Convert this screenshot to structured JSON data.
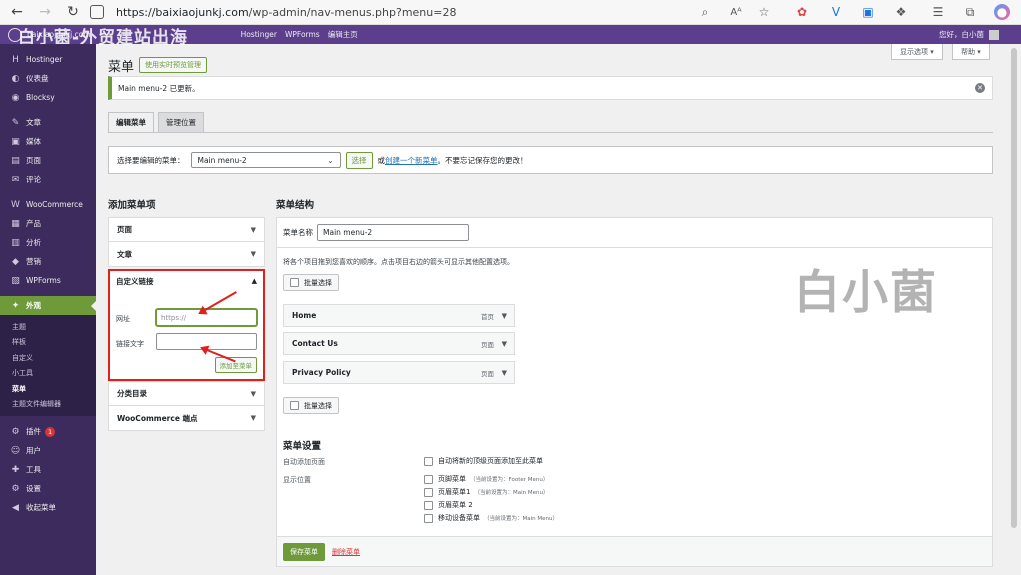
{
  "browser": {
    "url_domain": "https://baixiaojunkj.com",
    "url_path": "/wp-admin/nav-menus.php?menu=28",
    "back": "←",
    "forward": "→",
    "refresh": "↻"
  },
  "adminbar": {
    "overlay_title": "白小菌-外贸建站出海",
    "site": "baixiaojunkj.com",
    "items": [
      "Hostinger",
      "WPForms",
      "编辑主页"
    ],
    "greeting": "您好，白小菌"
  },
  "sidebar": {
    "items": [
      {
        "label": "Hostinger",
        "icon": "H"
      },
      {
        "label": "仪表盘",
        "icon": "◐"
      },
      {
        "label": "Blocksy",
        "icon": "◉"
      },
      {
        "label": "文章",
        "icon": "✎"
      },
      {
        "label": "媒体",
        "icon": "▣"
      },
      {
        "label": "页面",
        "icon": "▤"
      },
      {
        "label": "评论",
        "icon": "✉"
      },
      {
        "label": "WooCommerce",
        "icon": "W"
      },
      {
        "label": "产品",
        "icon": "▦"
      },
      {
        "label": "分析",
        "icon": "▥"
      },
      {
        "label": "营销",
        "icon": "◆"
      },
      {
        "label": "WPForms",
        "icon": "▧"
      },
      {
        "label": "外观",
        "icon": "✦"
      },
      {
        "label": "插件",
        "icon": "⚙",
        "badge": "1"
      },
      {
        "label": "用户",
        "icon": "☺"
      },
      {
        "label": "工具",
        "icon": "✚"
      },
      {
        "label": "设置",
        "icon": "⚙"
      },
      {
        "label": "收起菜单",
        "icon": "◀"
      }
    ],
    "submenu": [
      "主题",
      "样板",
      "自定义",
      "小工具",
      "菜单",
      "主题文件编辑器"
    ]
  },
  "header": {
    "screen_options": "显示选项 ▾",
    "help": "帮助 ▾",
    "title": "菜单",
    "live_preview": "使用实时预览管理"
  },
  "notice": {
    "text": "Main menu-2 已更新。",
    "close": "✕"
  },
  "tabs": [
    "编辑菜单",
    "管理位置"
  ],
  "select_menu": {
    "label": "选择要编辑的菜单：",
    "value": "Main menu-2",
    "select_btn": "选择",
    "or": "或",
    "create_link": "创建一个新菜单",
    "suffix": "。不要忘记保存您的更改！"
  },
  "add_items": {
    "title": "添加菜单项",
    "panels": [
      "页面",
      "文章"
    ],
    "custom": {
      "title": "自定义链接",
      "url_label": "网址",
      "url_placeholder": "https://",
      "text_label": "链接文字",
      "add_btn": "添加至菜单"
    },
    "panels_after": [
      "分类目录",
      "WooCommerce 端点"
    ]
  },
  "structure": {
    "title": "菜单结构",
    "name_label": "菜单名称",
    "name_value": "Main menu-2",
    "desc": "将各个项目拖到您喜欢的顺序。点击项目右边的箭头可显示其他配置选项。",
    "bulk": "批量选择",
    "items": [
      {
        "label": "Home",
        "type": "首页"
      },
      {
        "label": "Contact Us",
        "type": "页面"
      },
      {
        "label": "Privacy Policy",
        "type": "页面"
      }
    ],
    "watermark": "白小菌"
  },
  "settings": {
    "title": "菜单设置",
    "auto_label": "自动添加页面",
    "auto_opt": "自动将新的顶级页面添加至此菜单",
    "loc_label": "显示位置",
    "locations": [
      {
        "label": "页脚菜单",
        "note": "（当前设置为：Footer Menu）"
      },
      {
        "label": "页眉菜单1",
        "note": "（当前设置为：Main Menu）"
      },
      {
        "label": "页眉菜单 2",
        "note": ""
      },
      {
        "label": "移动设备菜单",
        "note": "（当前设置为：Main Menu）"
      }
    ]
  },
  "footer": {
    "save": "保存菜单",
    "delete": "删除菜单"
  },
  "colors": {
    "accent": "#6e9a3a",
    "admin_bar": "#5b3f8c",
    "sidebar": "#3c2b5c",
    "highlight": "#e0201d"
  }
}
